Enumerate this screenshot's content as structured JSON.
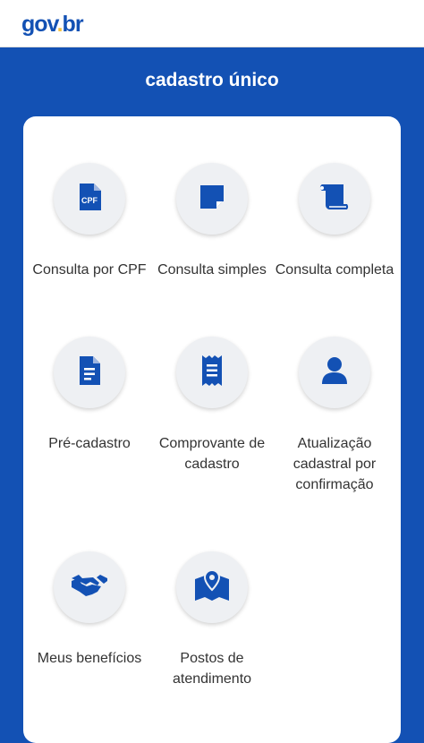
{
  "header": {
    "logo": {
      "gov": "gov",
      "dot": ".",
      "br": "br"
    }
  },
  "page": {
    "title": "cadastro único"
  },
  "services": [
    {
      "label": "Consulta por CPF",
      "icon": "cpf-document-icon"
    },
    {
      "label": "Consulta simples",
      "icon": "sticky-note-icon"
    },
    {
      "label": "Consulta completa",
      "icon": "scroll-icon"
    },
    {
      "label": "Pré-cadastro",
      "icon": "document-lines-icon"
    },
    {
      "label": "Comprovante de cadastro",
      "icon": "receipt-icon"
    },
    {
      "label": "Atualização cadastral por confirmação",
      "icon": "user-icon"
    },
    {
      "label": "Meus benefícios",
      "icon": "handshake-icon"
    },
    {
      "label": "Postos de atendimento",
      "icon": "map-pin-icon"
    }
  ],
  "icon_text": {
    "cpf": "CPF"
  },
  "colors": {
    "brand_blue": "#1351b4",
    "logo_yellow": "#f6c343",
    "card_background": "#ffffff",
    "icon_circle": "#eef0f3"
  }
}
